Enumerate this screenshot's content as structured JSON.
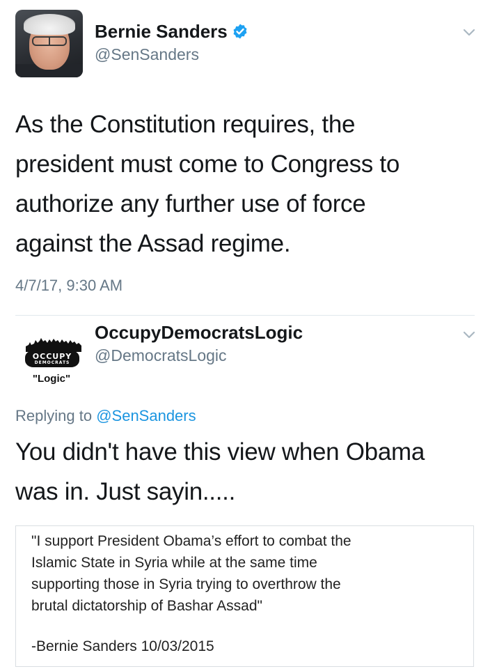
{
  "tweet1": {
    "display_name": "Bernie Sanders",
    "handle": "@SenSanders",
    "text_lines": [
      "As the Constitution requires, the",
      "president must come to Congress to",
      "authorize any further use of force",
      "against the Assad regime."
    ],
    "timestamp": "4/7/17, 9:30 AM"
  },
  "tweet2": {
    "display_name": "OccupyDemocratsLogic",
    "handle": "@DemocratsLogic",
    "avatar_logo": {
      "word": "OCCUPY",
      "sub": "DEMOCRATS",
      "caption": "\"Logic\""
    },
    "replying_prefix": "Replying to",
    "replying_mention": "@SenSanders",
    "text_lines": [
      "You didn't have this view when Obama",
      "was in. Just sayin....."
    ],
    "quote": {
      "lines": [
        "\"I support President Obama’s effort to combat the",
        "Islamic State in Syria while at the same time",
        "supporting those in Syria trying to overthrow the",
        "brutal dictatorship of Bashar Assad\""
      ],
      "attribution": "-Bernie Sanders 10/03/2015"
    }
  },
  "colors": {
    "text": "#14171a",
    "secondary": "#657786",
    "link": "#1b95e0",
    "verified": "#1da1f2",
    "divider": "#e1e8ed"
  },
  "icons": {
    "verified": "verified-badge-icon",
    "chevron": "chevron-down-icon"
  }
}
